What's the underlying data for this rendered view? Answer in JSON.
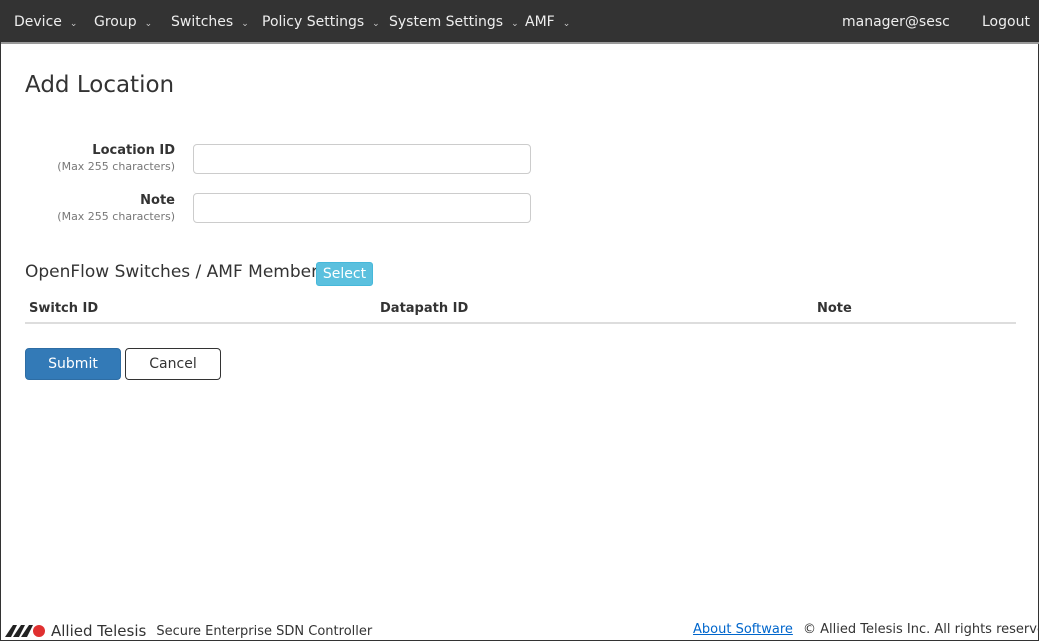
{
  "nav": {
    "items": [
      "Device",
      "Group",
      "Switches",
      "Policy Settings",
      "System Settings",
      "AMF"
    ],
    "user": "manager@sesc",
    "logout": "Logout"
  },
  "page": {
    "title": "Add Location"
  },
  "form": {
    "location_id": {
      "label": "Location ID",
      "hint": "(Max 255 characters)",
      "value": ""
    },
    "note": {
      "label": "Note",
      "hint": "(Max 255 characters)",
      "value": ""
    }
  },
  "section": {
    "title": "OpenFlow Switches / AMF Members",
    "select": "Select",
    "columns": [
      "Switch ID",
      "Datapath ID",
      "Note"
    ]
  },
  "actions": {
    "submit": "Submit",
    "cancel": "Cancel"
  },
  "footer": {
    "brand": "Allied Telesis",
    "product": "Secure Enterprise SDN Controller",
    "about": "About Software",
    "copyright": "© Allied Telesis Inc. All rights reserved."
  }
}
